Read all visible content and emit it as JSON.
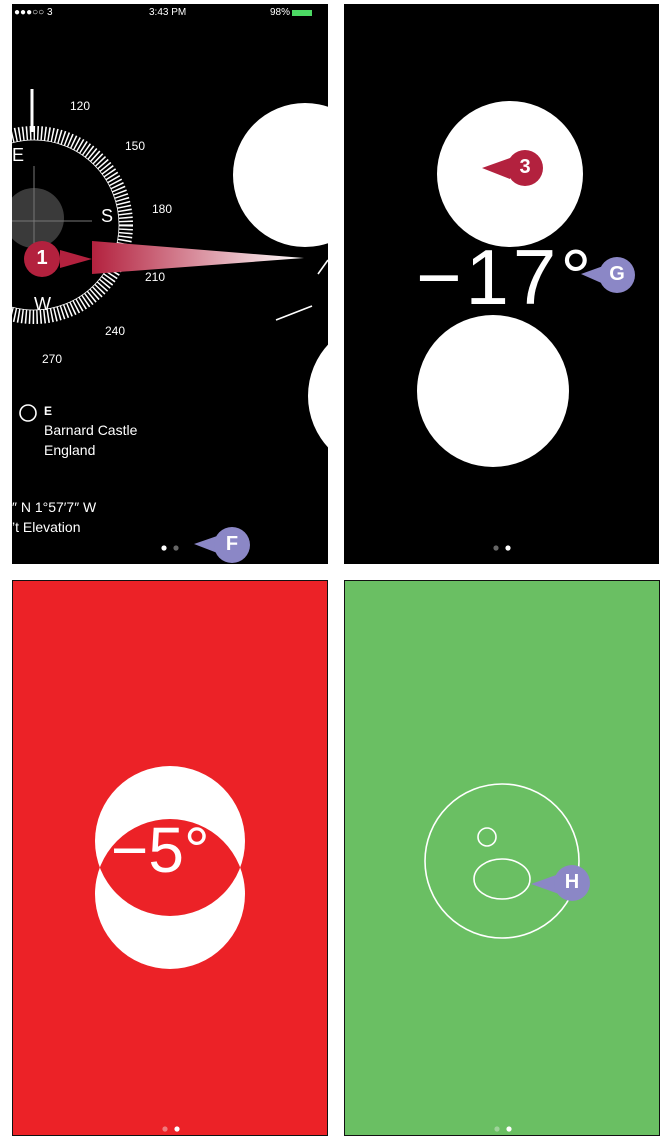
{
  "panel1": {
    "status": {
      "carrier": "●●●○○ 3",
      "time": "3:43 PM",
      "battery": "98%"
    },
    "compass": {
      "degree_labels": [
        "120",
        "150",
        "180",
        "210",
        "240",
        "270"
      ],
      "cardinals": {
        "east": "E",
        "south": "S",
        "west": "W"
      }
    },
    "location": {
      "heading": "E",
      "place": "Barnard Castle",
      "country": "England",
      "coordinates": "″ N  1°57′7″ W",
      "elevation": "’t Elevation"
    },
    "callout": "1",
    "page_callout": "F"
  },
  "panel2": {
    "reading": "−17°",
    "callout_top": "3",
    "callout_degree": "G"
  },
  "panel3": {
    "reading": "−5°",
    "background": "#ec2227"
  },
  "panel4": {
    "background": "#6abf63",
    "callout": "H"
  },
  "colors": {
    "callout_red": "#b3213e",
    "callout_purple": "#8b87c6"
  }
}
